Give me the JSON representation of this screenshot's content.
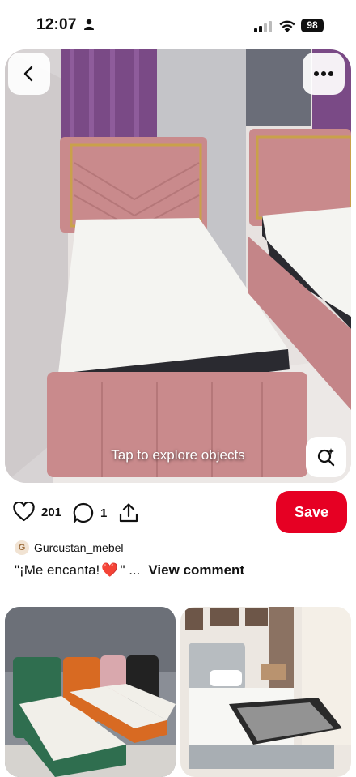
{
  "status_bar": {
    "time": "12:07",
    "battery": "98"
  },
  "pin": {
    "explore_label": "Tap to explore objects",
    "likes": "201",
    "comments": "1",
    "save_label": "Save"
  },
  "comment": {
    "avatar_initial": "G",
    "author": "Gurcustan_mebel",
    "text_start": "\"¡Me encanta! ",
    "emoji": "❤️",
    "text_end": "\" ...",
    "view_label": "View comment"
  },
  "colors": {
    "save": "#e60023",
    "bed_pink": "#c98a8c",
    "accent_gold": "#c9a14a"
  }
}
